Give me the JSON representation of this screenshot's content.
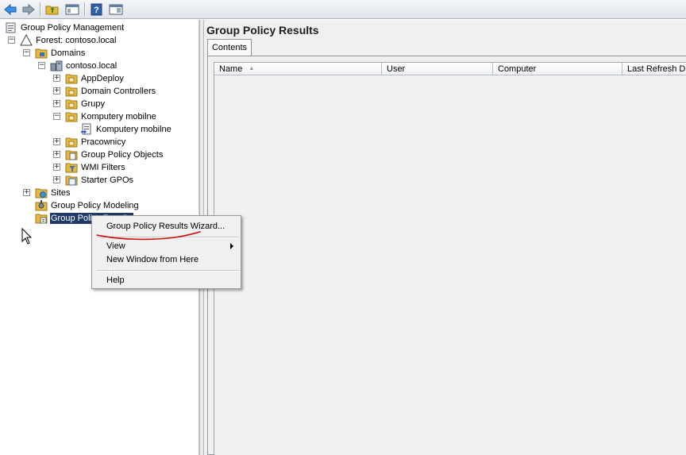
{
  "toolbar": {
    "buttons": [
      {
        "name": "back-icon",
        "glyph": "⇦"
      },
      {
        "name": "forward-icon",
        "glyph": "⇨"
      },
      {
        "name": "up-folder-icon"
      },
      {
        "name": "show-hide-console-tree-icon"
      },
      {
        "name": "help-icon",
        "glyph": "?"
      },
      {
        "name": "show-action-pane-icon"
      }
    ]
  },
  "tree": {
    "root": "Group Policy Management",
    "forest": "Forest: contoso.local",
    "domains": "Domains",
    "domain": "contoso.local",
    "items": {
      "appdeploy": "AppDeploy",
      "domain_controllers": "Domain Controllers",
      "grupy": "Grupy",
      "komputery_mobilne": "Komputery mobilne",
      "komputery_mobilne_gpo": "Komputery mobilne",
      "pracownicy": "Pracownicy",
      "gpo": "Group Policy Objects",
      "wmi": "WMI Filters",
      "starter": "Starter GPOs"
    },
    "sites": "Sites",
    "modeling": "Group Policy Modeling",
    "results_selected": "Group Policy Results"
  },
  "right": {
    "title": "Group Policy Results",
    "tab": "Contents",
    "columns": {
      "name": "Name",
      "user": "User",
      "computer": "Computer",
      "last_refresh": "Last Refresh Da"
    }
  },
  "context_menu": {
    "wizard": "Group Policy Results Wizard...",
    "view": "View",
    "new_window": "New Window from Here",
    "help": "Help"
  },
  "colors": {
    "selection": "#1f3a66",
    "annotation": "#cc1111",
    "folder": "#e9b93c"
  }
}
